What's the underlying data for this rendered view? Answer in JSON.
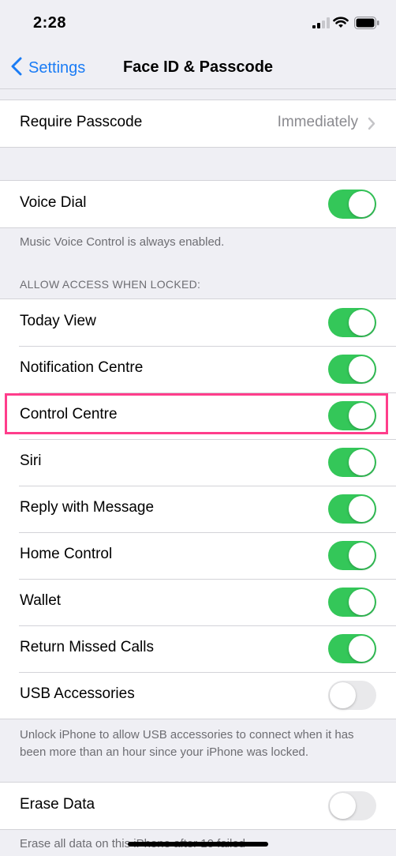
{
  "status_bar": {
    "time": "2:28"
  },
  "nav": {
    "back_label": "Settings",
    "title": "Face ID & Passcode"
  },
  "require_passcode": {
    "label": "Require Passcode",
    "value": "Immediately"
  },
  "voice_dial": {
    "label": "Voice Dial",
    "state": "on",
    "note": "Music Voice Control is always enabled."
  },
  "allow_access": {
    "header": "ALLOW ACCESS WHEN LOCKED:",
    "items": [
      {
        "label": "Today View",
        "state": "on"
      },
      {
        "label": "Notification Centre",
        "state": "on"
      },
      {
        "label": "Control Centre",
        "state": "on"
      },
      {
        "label": "Siri",
        "state": "on"
      },
      {
        "label": "Reply with Message",
        "state": "on"
      },
      {
        "label": "Home Control",
        "state": "on"
      },
      {
        "label": "Wallet",
        "state": "on"
      },
      {
        "label": "Return Missed Calls",
        "state": "on"
      },
      {
        "label": "USB Accessories",
        "state": "off"
      }
    ],
    "note": "Unlock iPhone to allow USB accessories to connect when it has been more than an hour since your iPhone was locked."
  },
  "erase_data": {
    "label": "Erase Data",
    "state": "off",
    "note": "Erase all data on this iPhone after 10 failed"
  },
  "colors": {
    "toggle_on": "#34c759",
    "toggle_off": "#e9e9eb",
    "link": "#1a7cf5",
    "highlight": "#ff3d8b"
  },
  "icons": [
    "signal-icon",
    "wifi-icon",
    "battery-icon",
    "back-chevron-icon",
    "chevron-right-icon"
  ]
}
